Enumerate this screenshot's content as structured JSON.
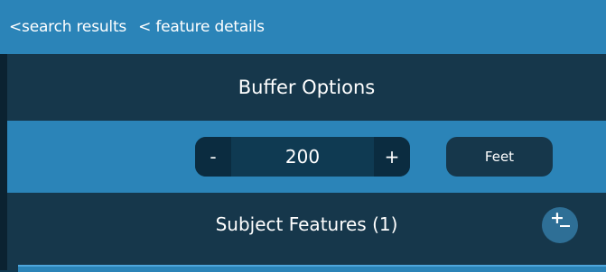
{
  "breadcrumb": {
    "search_results": "<search results",
    "feature_details": "< feature details"
  },
  "buffer_options": {
    "title": "Buffer Options",
    "minus_label": "-",
    "value": "200",
    "plus_label": "+",
    "unit": "Feet"
  },
  "subject_features": {
    "title": "Subject Features (1)",
    "add_remove_icon": "plus-minus-icon"
  },
  "colors": {
    "accent": "#2b84b8",
    "dark_panel": "#16374b",
    "darker": "#0b2c40"
  }
}
